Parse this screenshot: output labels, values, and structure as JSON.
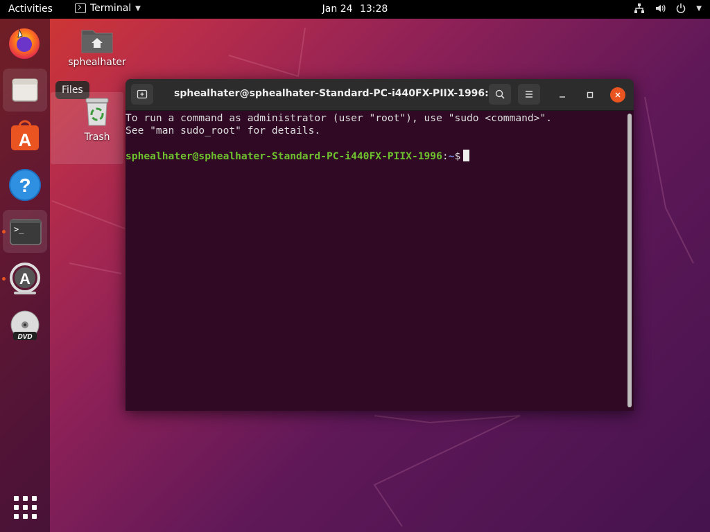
{
  "topbar": {
    "activities": "Activities",
    "app_name": "Terminal",
    "date": "Jan 24",
    "time": "13:28"
  },
  "dock": {
    "items": [
      {
        "name": "Firefox",
        "icon": "firefox-icon"
      },
      {
        "name": "Files",
        "icon": "files-icon"
      },
      {
        "name": "Ubuntu Software",
        "icon": "software-icon"
      },
      {
        "name": "Help",
        "icon": "help-icon"
      },
      {
        "name": "Terminal",
        "icon": "terminal-icon"
      },
      {
        "name": "Software Updater",
        "icon": "updater-icon"
      },
      {
        "name": "DVD",
        "icon": "dvd-icon"
      }
    ],
    "tooltip": "Files"
  },
  "desktop": {
    "home_label": "sphealhater",
    "trash_label": "Trash"
  },
  "terminal": {
    "title": "sphealhater@sphealhater-Standard-PC-i440FX-PIIX-1996: ~",
    "line1": "To run a command as administrator (user \"root\"), use \"sudo <command>\".",
    "line2": "See \"man sudo_root\" for details.",
    "prompt_user": "sphealhater@sphealhater-Standard-PC-i440FX-PIIX-1996",
    "prompt_sep": ":",
    "prompt_path": "~",
    "prompt_end": "$"
  },
  "colors": {
    "accent": "#e95420",
    "terminal_bg": "#300a24",
    "prompt_green": "#6ec12e",
    "prompt_blue": "#7b8fe6"
  }
}
